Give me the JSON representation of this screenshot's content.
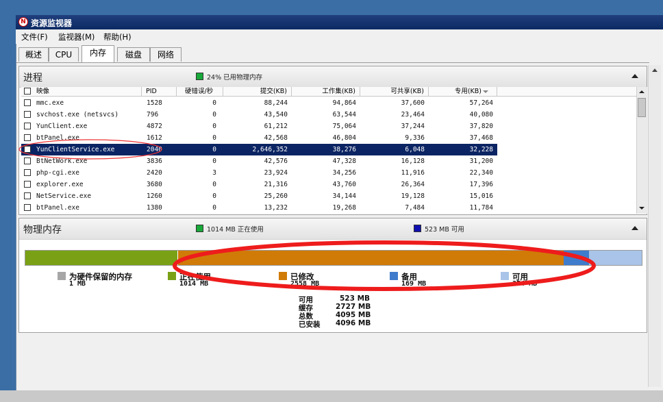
{
  "window": {
    "title": "资源监视器"
  },
  "menu": [
    "文件(F)",
    "监视器(M)",
    "帮助(H)"
  ],
  "tabs": [
    "概述",
    "CPU",
    "内存",
    "磁盘",
    "网络"
  ],
  "processes": {
    "title": "进程",
    "usage_label": "24% 已用物理内存",
    "columns": [
      "映像",
      "PID",
      "硬错误/秒",
      "提交(KB)",
      "工作集(KB)",
      "可共享(KB)",
      "专用(KB)"
    ],
    "rows": [
      {
        "name": "mmc.exe",
        "pid": "1528",
        "hard": "0",
        "commit": "88,244",
        "ws": "94,864",
        "share": "37,600",
        "priv": "57,264"
      },
      {
        "name": "svchost.exe (netsvcs)",
        "pid": "796",
        "hard": "0",
        "commit": "43,540",
        "ws": "63,544",
        "share": "23,464",
        "priv": "40,080"
      },
      {
        "name": "YunClient.exe",
        "pid": "4872",
        "hard": "0",
        "commit": "61,212",
        "ws": "75,064",
        "share": "37,244",
        "priv": "37,820"
      },
      {
        "name": "btPanel.exe",
        "pid": "1612",
        "hard": "0",
        "commit": "42,568",
        "ws": "46,804",
        "share": "9,336",
        "priv": "37,468"
      },
      {
        "name": "YunClientService.exe",
        "pid": "2040",
        "hard": "0",
        "commit": "2,646,352",
        "ws": "38,276",
        "share": "6,048",
        "priv": "32,228",
        "selected": true
      },
      {
        "name": "BtNetWork.exe",
        "pid": "3836",
        "hard": "0",
        "commit": "42,576",
        "ws": "47,328",
        "share": "16,128",
        "priv": "31,200"
      },
      {
        "name": "php-cgi.exe",
        "pid": "2420",
        "hard": "3",
        "commit": "23,924",
        "ws": "34,256",
        "share": "11,916",
        "priv": "22,340"
      },
      {
        "name": "explorer.exe",
        "pid": "3680",
        "hard": "0",
        "commit": "21,316",
        "ws": "43,760",
        "share": "26,364",
        "priv": "17,396"
      },
      {
        "name": "NetService.exe",
        "pid": "1260",
        "hard": "0",
        "commit": "25,260",
        "ws": "34,144",
        "share": "19,128",
        "priv": "15,016"
      },
      {
        "name": "btPanel.exe",
        "pid": "1380",
        "hard": "0",
        "commit": "13,232",
        "ws": "19,268",
        "share": "7,484",
        "priv": "11,784"
      }
    ]
  },
  "physical": {
    "title": "物理内存",
    "inuse_label": "1014 MB 正在使用",
    "avail_label": "523 MB 可用",
    "legend": [
      {
        "label": "为硬件保留的内存",
        "value": "1 MB",
        "color": "#a6a6a6"
      },
      {
        "label": "正在使用",
        "value": "1014 MB",
        "color": "#7aa116"
      },
      {
        "label": "已修改",
        "value": "2558 MB",
        "color": "#d07b08"
      },
      {
        "label": "备用",
        "value": "169 MB",
        "color": "#3f7ccc"
      },
      {
        "label": "可用",
        "value": "354 MB",
        "color": "#a9c4e8"
      }
    ],
    "stats": [
      {
        "label": "可用",
        "value": "523 MB"
      },
      {
        "label": "缓存",
        "value": "2727 MB"
      },
      {
        "label": "总数",
        "value": "4095 MB"
      },
      {
        "label": "已安装",
        "value": "4096 MB"
      }
    ],
    "bar_mb": {
      "hardware": 1,
      "inuse": 1014,
      "modified": 2558,
      "standby": 169,
      "free": 354
    }
  }
}
